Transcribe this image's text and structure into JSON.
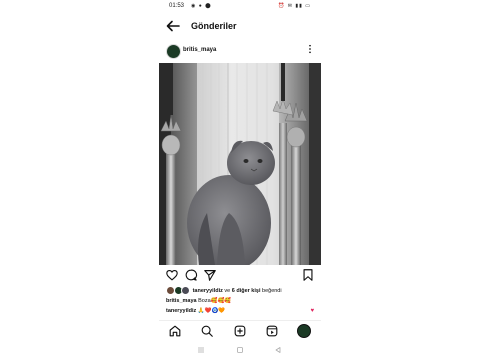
{
  "status": {
    "time": "01:53",
    "left_icons": "◉ ● ⬤",
    "right_icons": "⏰ ✉ ▮▮ ▭"
  },
  "header": {
    "title": "Gönderiler"
  },
  "post": {
    "username": "britis_maya",
    "liked_by_user": "taneryyildiz",
    "liked_by_rest": " ve ",
    "liked_by_others": "6 diğer kişi",
    "liked_suffix": " beğendi",
    "caption_user": "britis_maya",
    "caption_text": " Boza🥰🥰🥰",
    "comment_user": "taneryyildiz",
    "comment_text": " 🙏❤️🧿🧡"
  },
  "colors": {
    "accent": "#e0245e",
    "avatar_bg": "#1b3a25"
  },
  "icons": [
    "arrow-left-icon",
    "more-vertical-icon",
    "heart-icon",
    "comment-icon",
    "send-icon",
    "bookmark-icon",
    "home-icon",
    "search-icon",
    "add-post-icon",
    "reels-icon",
    "profile-avatar-icon",
    "nav-menu-icon",
    "nav-home-icon",
    "nav-back-icon"
  ]
}
